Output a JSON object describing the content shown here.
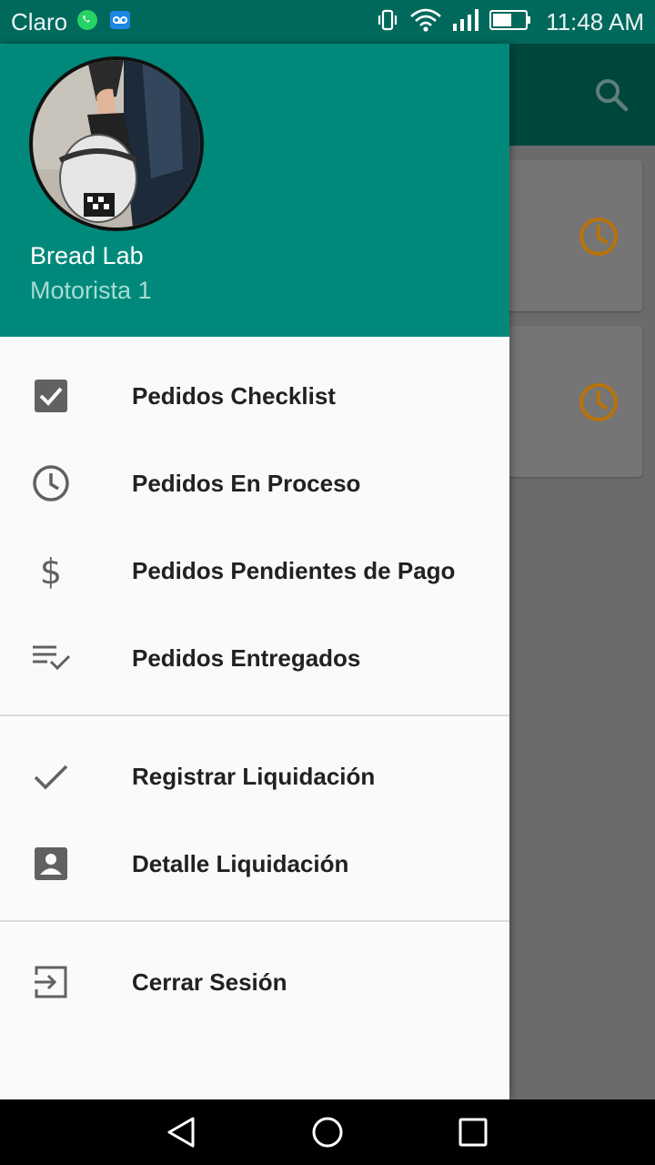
{
  "status_bar": {
    "carrier": "Claro",
    "time": "11:48 AM",
    "notification_icons": [
      "whatsapp-icon",
      "voicemail-icon"
    ],
    "system_icons": [
      "vibrate-icon",
      "wifi-icon",
      "signal-icon",
      "battery-icon"
    ]
  },
  "background_app": {
    "toolbar_icon": "search-icon",
    "card_icon": "clock-icon",
    "accent_color": "#b8730a"
  },
  "drawer": {
    "header": {
      "user_name": "Bread Lab",
      "user_role": "Motorista 1",
      "avatar": "avatar-photo"
    },
    "sections": [
      {
        "items": [
          {
            "label": "Pedidos Checklist",
            "icon": "checkbox-icon"
          },
          {
            "label": "Pedidos En Proceso",
            "icon": "clock-icon"
          },
          {
            "label": "Pedidos Pendientes de Pago",
            "icon": "dollar-icon"
          },
          {
            "label": "Pedidos Entregados",
            "icon": "playlist-check-icon"
          }
        ]
      },
      {
        "items": [
          {
            "label": "Registrar Liquidación",
            "icon": "check-icon"
          },
          {
            "label": "Detalle Liquidación",
            "icon": "account-box-icon"
          }
        ]
      },
      {
        "items": [
          {
            "label": "Cerrar Sesión",
            "icon": "exit-icon"
          }
        ]
      }
    ]
  },
  "nav_bar": {
    "buttons": [
      "back-icon",
      "home-icon",
      "recents-icon"
    ]
  },
  "colors": {
    "primary": "#00897b",
    "primary_dark": "#00695c",
    "drawer_bg": "#fafafa",
    "text_primary": "#212121",
    "icon_grey": "#616161"
  }
}
